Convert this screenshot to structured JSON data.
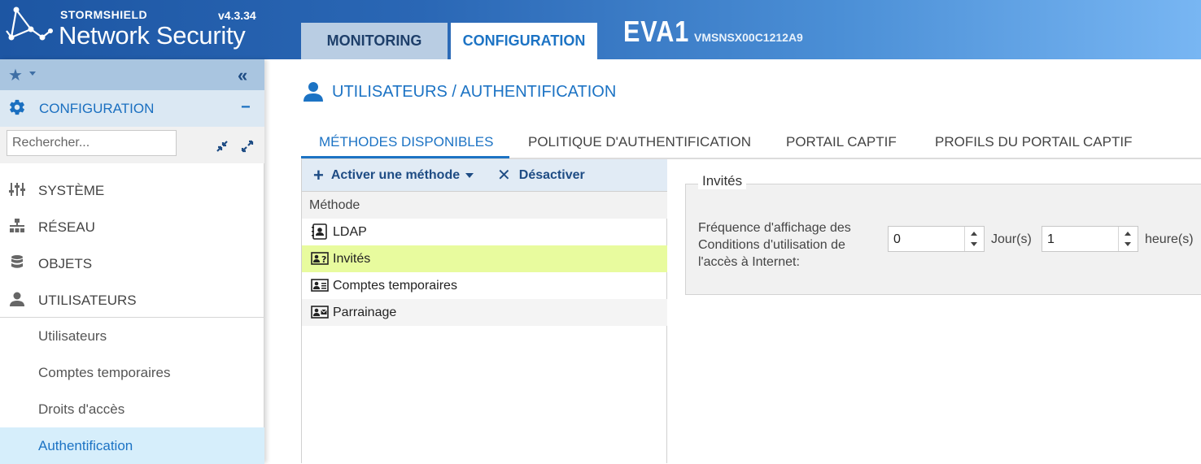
{
  "header": {
    "brand_small": "STORMSHIELD",
    "brand_big": "Network Security",
    "version": "v4.3.34",
    "tabs": [
      {
        "label": "MONITORING"
      },
      {
        "label": "CONFIGURATION"
      }
    ],
    "device_name": "EVA1",
    "device_serial": "VMSNSX00C1212A9"
  },
  "sidebar": {
    "favorites_icon": "star-icon",
    "collapse_icon": "double-chevron-left-icon",
    "section_title": "CONFIGURATION",
    "section_toggle": "−",
    "search_placeholder": "Rechercher...",
    "items": [
      {
        "label": "SYSTÈME",
        "icon": "sliders-icon"
      },
      {
        "label": "RÉSEAU",
        "icon": "network-icon"
      },
      {
        "label": "OBJETS",
        "icon": "database-icon"
      },
      {
        "label": "UTILISATEURS",
        "icon": "user-icon"
      }
    ],
    "sub_items": [
      {
        "label": "Utilisateurs"
      },
      {
        "label": "Comptes temporaires"
      },
      {
        "label": "Droits d'accès"
      },
      {
        "label": "Authentification",
        "active": true
      }
    ]
  },
  "main": {
    "page_title": "UTILISATEURS / AUTHENTIFICATION",
    "tabs": [
      {
        "label": "MÉTHODES DISPONIBLES",
        "active": true
      },
      {
        "label": "POLITIQUE D'AUTHENTIFICATION"
      },
      {
        "label": "PORTAIL CAPTIF"
      },
      {
        "label": "PROFILS DU PORTAIL CAPTIF"
      }
    ],
    "toolbar": {
      "add_label": "Activer une méthode",
      "deactivate_label": "Désactiver"
    },
    "table": {
      "column": "Méthode",
      "rows": [
        {
          "label": "LDAP",
          "icon": "address-book-icon"
        },
        {
          "label": "Invités",
          "icon": "guest-card-icon",
          "selected": true
        },
        {
          "label": "Comptes temporaires",
          "icon": "id-card-icon"
        },
        {
          "label": "Parrainage",
          "icon": "sponsor-card-icon"
        }
      ]
    },
    "guests": {
      "legend": "Invités",
      "frequency_label": "Fréquence d'affichage des Conditions d'utilisation de l'accès à Internet:",
      "days_value": "0",
      "days_unit": "Jour(s)",
      "hours_value": "1",
      "hours_unit": "heure(s)"
    }
  },
  "colors": {
    "accent": "#1c73c4",
    "header_start": "#1d56a3",
    "header_end": "#78b6f3",
    "selected_row": "#e8fb9e",
    "active_sub_item": "#d6eefb"
  }
}
